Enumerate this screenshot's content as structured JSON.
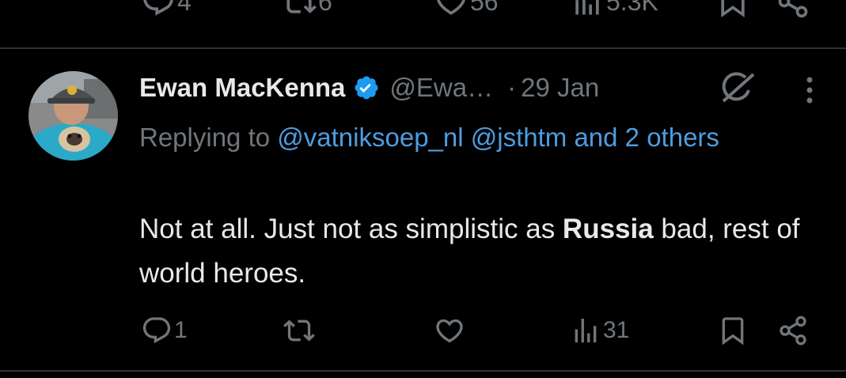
{
  "previous_tweet": {
    "replies": "4",
    "reposts": "6",
    "likes": "56",
    "views": "5.3K"
  },
  "tweet": {
    "author": {
      "display_name": "Ewan MacKenna",
      "handle": "@Ewa…",
      "verified": true
    },
    "separator": "·",
    "date": "29 Jan",
    "replying_prefix": "Replying to",
    "replying_to": [
      "@vatniksoep_nl",
      "@jsthtm"
    ],
    "and_others": "and 2 others",
    "text_before": "Not at all. Just not as simplistic as ",
    "text_bold": "Russia",
    "text_after": " bad, rest of world heroes.",
    "actions": {
      "replies": "1",
      "reposts": "",
      "likes": "",
      "views": "31"
    }
  },
  "colors": {
    "background": "#000000",
    "text_primary": "#e7e9ea",
    "text_secondary": "#71767b",
    "link": "#4d9de0",
    "verified_badge": "#1d9bf0",
    "divider": "#2f3336"
  },
  "icons": [
    "reply-icon",
    "repost-icon",
    "like-icon",
    "views-icon",
    "bookmark-icon",
    "share-icon",
    "verified-badge-icon",
    "grok-icon",
    "more-icon"
  ]
}
